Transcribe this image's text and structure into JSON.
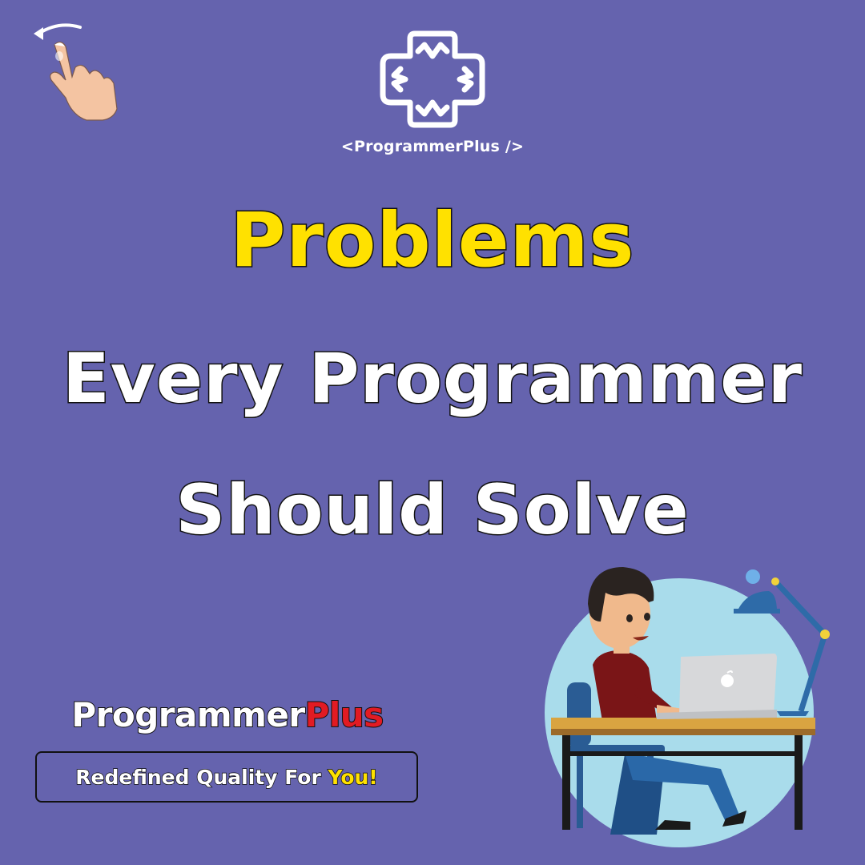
{
  "logo": {
    "text": "<ProgrammerPlus />"
  },
  "headline": {
    "line1": "Problems",
    "line2": "Every Programmer",
    "line3": "Should Solve"
  },
  "brand": {
    "name_part1": "Programmer",
    "name_part2": "Plus",
    "tagline_part1": "Redefined Quality For ",
    "tagline_part2": "You!"
  },
  "colors": {
    "background": "#6563AE",
    "accent_yellow": "#FFE100",
    "accent_red": "#E21B23",
    "circle": "#A9DCEB"
  },
  "icons": [
    "swipe-left-hand-icon",
    "programmerplus-logo-icon",
    "programmer-at-desk-illustration"
  ]
}
